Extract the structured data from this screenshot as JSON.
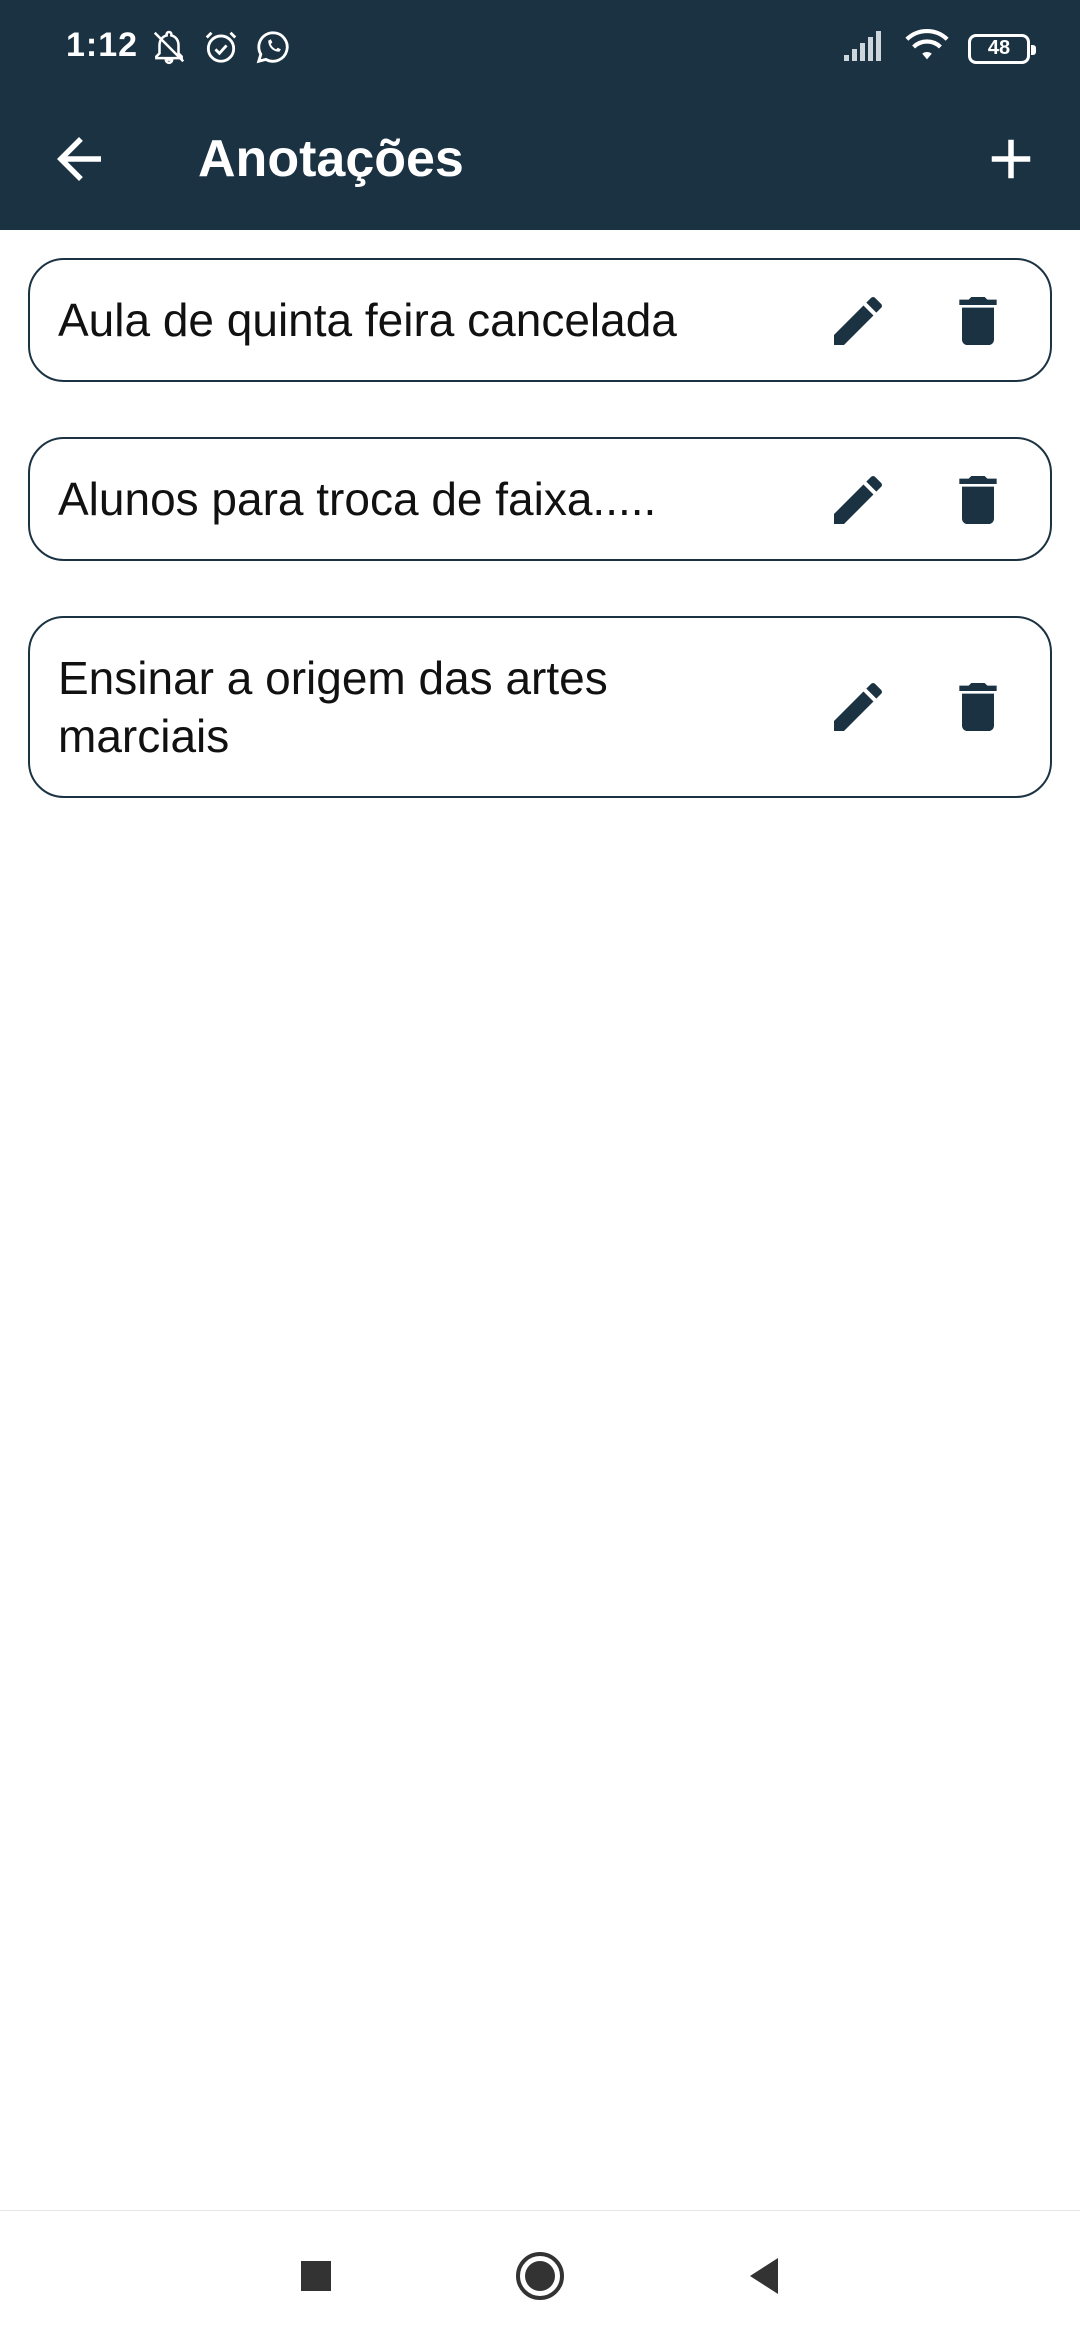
{
  "status_bar": {
    "time": "1:12",
    "battery": "48",
    "icons": [
      "bell-off-icon",
      "alarm-icon",
      "whatsapp-icon",
      "signal-icon",
      "wifi-icon",
      "battery-icon"
    ]
  },
  "app_bar": {
    "title": "Anotações",
    "back_icon": "arrow-left-icon",
    "add_icon": "plus-icon",
    "background": "#1b3242"
  },
  "notes": [
    {
      "text": "Aula de quinta feira cancelada"
    },
    {
      "text": "Alunos para troca de faixa....."
    },
    {
      "text": "Ensinar a origem das artes marciais"
    }
  ],
  "colors": {
    "primary": "#1b3242",
    "text": "#111111",
    "background": "#ffffff"
  }
}
